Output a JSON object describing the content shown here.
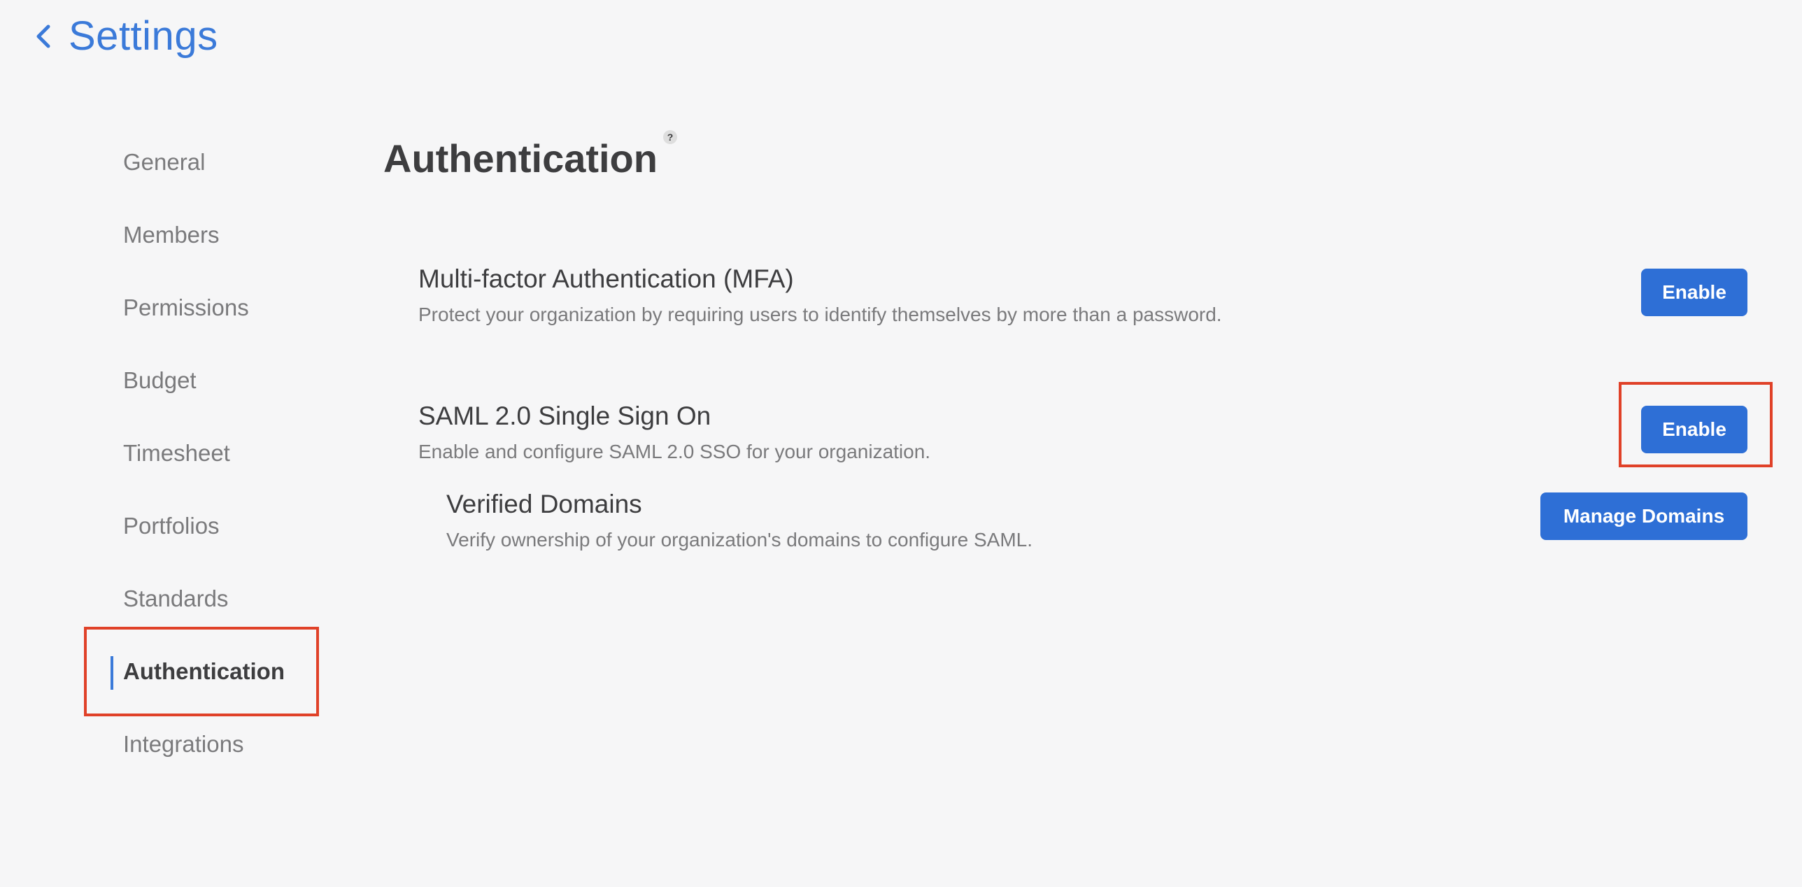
{
  "header": {
    "title": "Settings",
    "back_icon": "chevron-left-icon"
  },
  "sidebar": {
    "items": [
      {
        "label": "General",
        "active": false
      },
      {
        "label": "Members",
        "active": false
      },
      {
        "label": "Permissions",
        "active": false
      },
      {
        "label": "Budget",
        "active": false
      },
      {
        "label": "Timesheet",
        "active": false
      },
      {
        "label": "Portfolios",
        "active": false
      },
      {
        "label": "Standards",
        "active": false
      },
      {
        "label": "Authentication",
        "active": true
      },
      {
        "label": "Integrations",
        "active": false
      }
    ]
  },
  "main": {
    "title": "Authentication",
    "help_label": "?",
    "mfa": {
      "title": "Multi-factor Authentication (MFA)",
      "description": "Protect your organization by requiring users to identify themselves by more than a password.",
      "button_label": "Enable"
    },
    "saml": {
      "title": "SAML 2.0 Single Sign On",
      "description": "Enable and configure SAML 2.0 SSO for your organization.",
      "button_label": "Enable"
    },
    "domains": {
      "title": "Verified Domains",
      "description": "Verify ownership of your organization's domains to configure SAML.",
      "button_label": "Manage Domains"
    }
  },
  "colors": {
    "accent": "#3b7ad9",
    "button": "#2e6fd6",
    "highlight": "#e04128",
    "background": "#f6f6f7"
  }
}
